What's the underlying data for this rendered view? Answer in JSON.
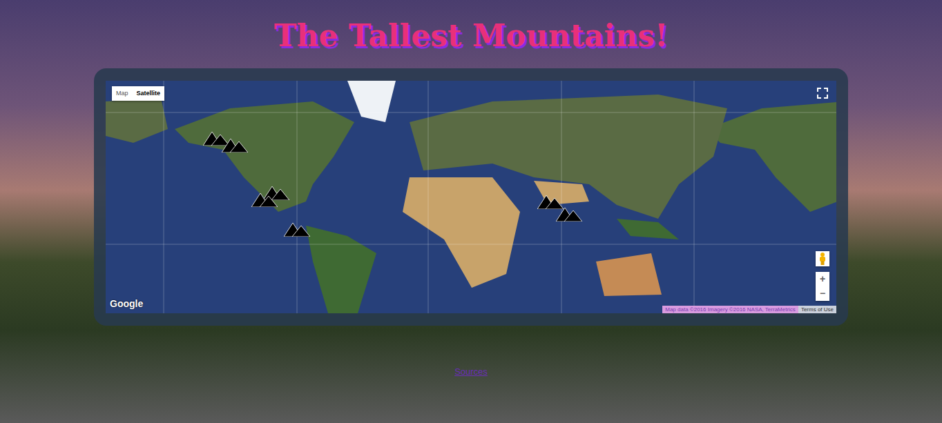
{
  "title": "The Tallest Mountains!",
  "map": {
    "type_buttons": [
      {
        "label": "Map",
        "selected": false
      },
      {
        "label": "Satellite",
        "selected": true
      }
    ],
    "logo": "Google",
    "attribution": "Map data ©2016 Imagery ©2016 NASA, TerraMetrics",
    "terms": "Terms of Use",
    "zoom_in": "+",
    "zoom_out": "−"
  },
  "footer_link": "Sources"
}
